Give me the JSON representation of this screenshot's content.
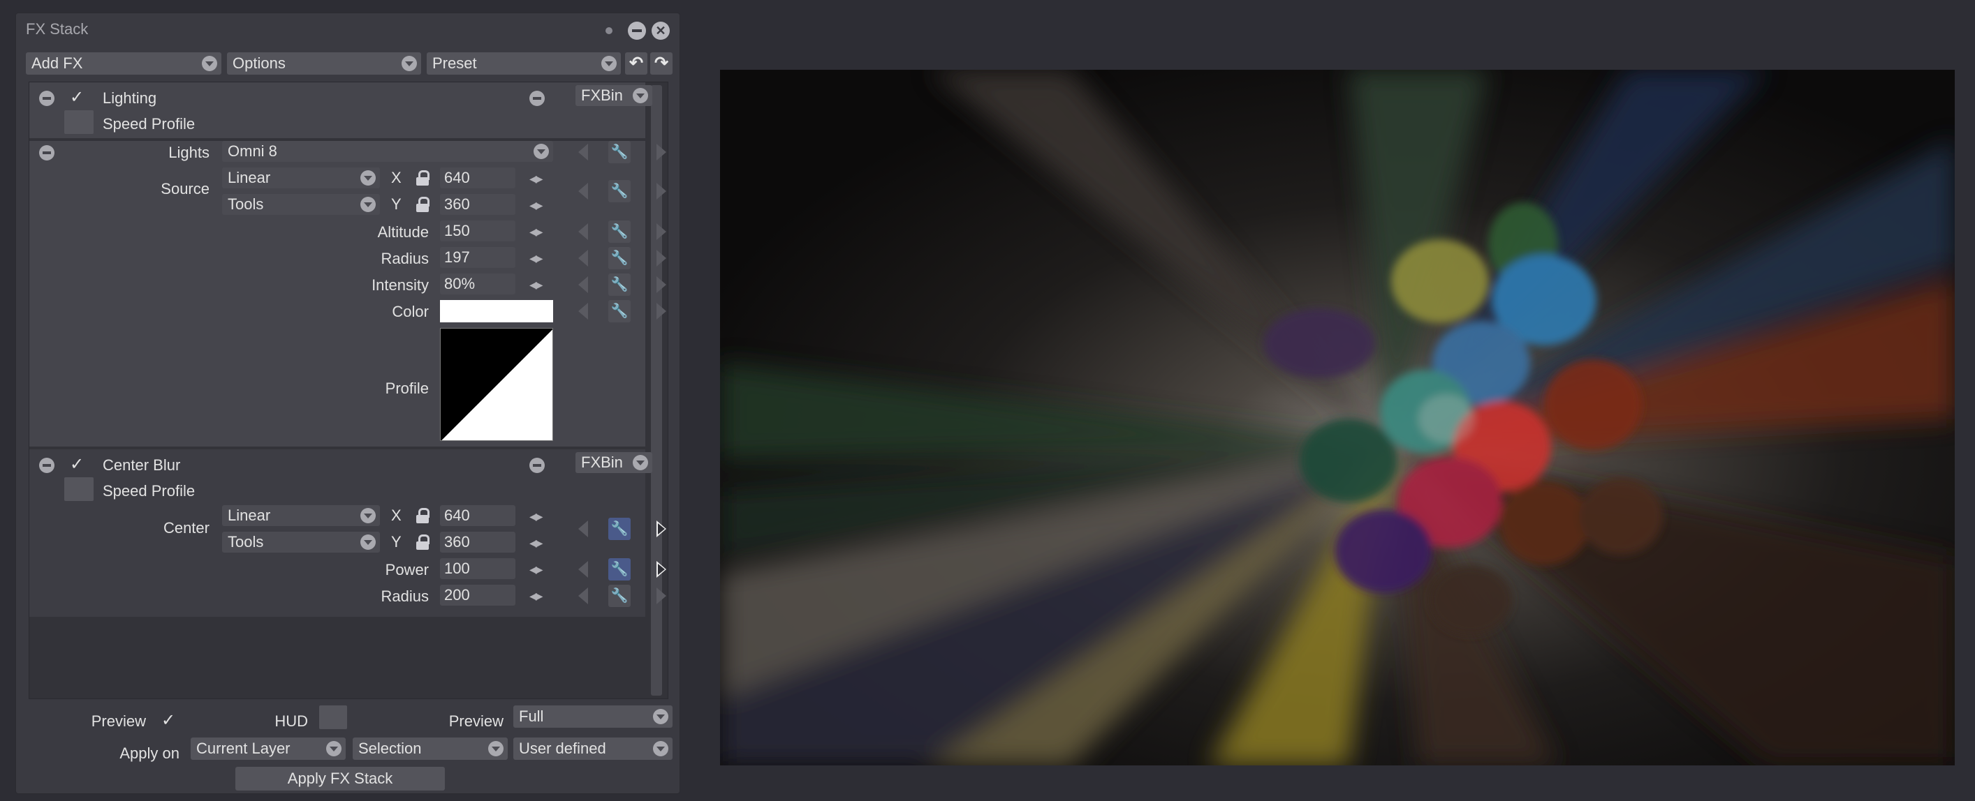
{
  "panel": {
    "title": "FX Stack",
    "toolbar": {
      "add_fx": "Add FX",
      "options": "Options",
      "preset": "Preset",
      "undo_icon": "undo-icon",
      "redo_icon": "redo-icon"
    }
  },
  "lighting": {
    "name": "Lighting",
    "enabled": true,
    "bin": "FXBin",
    "speed_profile": "Speed Profile",
    "lights_label": "Lights",
    "lights_value": "Omni 8",
    "source_label": "Source",
    "source_x_mode": "Linear",
    "source_y_mode": "Tools",
    "x_label": "X",
    "y_label": "Y",
    "x_value": "640",
    "y_value": "360",
    "altitude_label": "Altitude",
    "altitude_value": "150",
    "radius_label": "Radius",
    "radius_value": "197",
    "intensity_label": "Intensity",
    "intensity_value": "80%",
    "color_label": "Color",
    "color_value": "#ffffff",
    "profile_label": "Profile"
  },
  "center_blur": {
    "name": "Center Blur",
    "enabled": true,
    "bin": "FXBin",
    "speed_profile": "Speed Profile",
    "center_label": "Center",
    "center_x_mode": "Linear",
    "center_y_mode": "Tools",
    "x_label": "X",
    "y_label": "Y",
    "x_value": "640",
    "y_value": "360",
    "power_label": "Power",
    "power_value": "100",
    "radius_label": "Radius",
    "radius_value": "200"
  },
  "footer": {
    "preview_label": "Preview",
    "preview_checked": true,
    "hud_label": "HUD",
    "preview_mode_label": "Preview",
    "preview_mode_value": "Full",
    "apply_on_label": "Apply on",
    "apply_on_layer": "Current Layer",
    "apply_on_selection": "Selection",
    "apply_on_user": "User defined",
    "apply_button": "Apply FX Stack"
  },
  "colors": {
    "panel_bg": "#3a3a41",
    "section_bg": "#45454c",
    "active_key": "#4a5a8a",
    "app_bg": "#2d2d34"
  }
}
